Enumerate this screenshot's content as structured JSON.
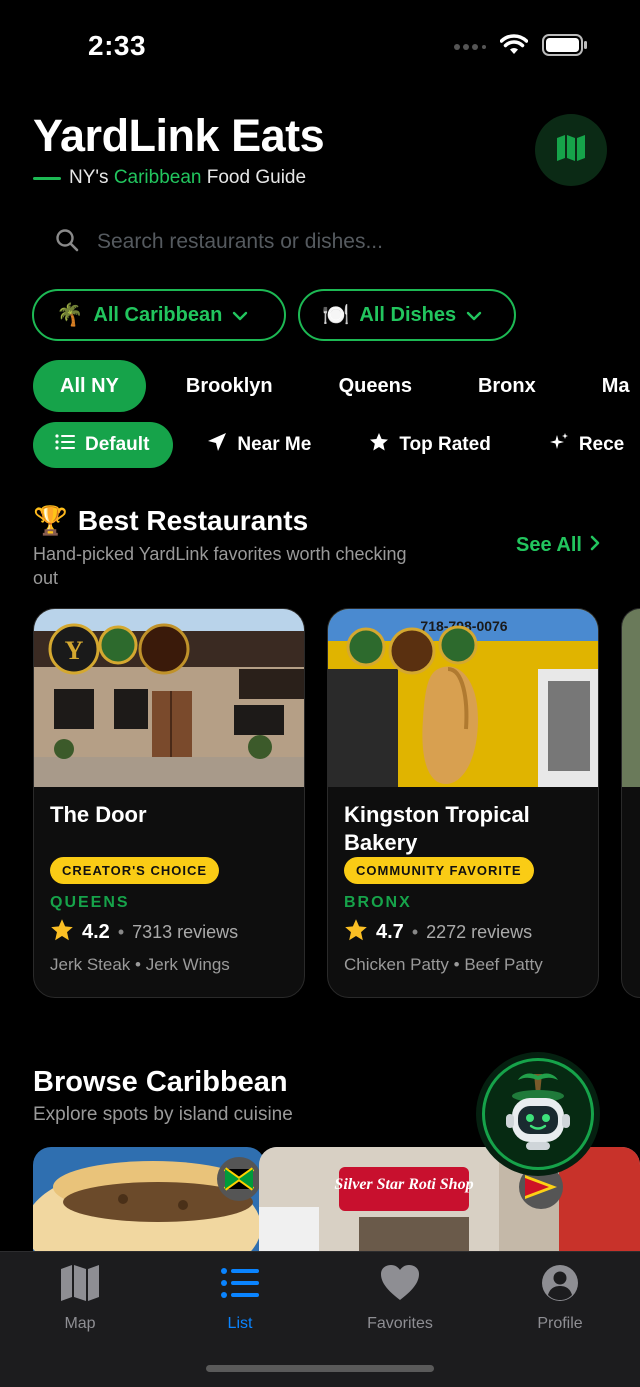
{
  "status_bar": {
    "time": "2:33"
  },
  "header": {
    "title": "YardLink Eats",
    "subtitle_pre": "NY's ",
    "subtitle_highlight": "Caribbean",
    "subtitle_post": " Food Guide"
  },
  "search": {
    "placeholder": "Search restaurants or dishes..."
  },
  "filters": [
    {
      "emoji": "🌴",
      "label": "All Caribbean"
    },
    {
      "emoji": "🍽️",
      "label": "All Dishes"
    }
  ],
  "boroughs": [
    "All NY",
    "Brooklyn",
    "Queens",
    "Bronx",
    "Ma"
  ],
  "sorts": [
    "Default",
    "Near Me",
    "Top Rated",
    "Rece"
  ],
  "best": {
    "emoji": "🏆",
    "title": "Best Restaurants",
    "subtitle": "Hand-picked YardLink favorites worth checking out",
    "see_all": "See All",
    "cards": [
      {
        "name": "The Door",
        "badge": "CREATOR'S CHOICE",
        "borough": "QUEENS",
        "rating": "4.2",
        "reviews": "7313 reviews",
        "dish1": "Jerk Steak",
        "dish2": "Jerk Wings"
      },
      {
        "name": "Kingston Tropical Bakery",
        "badge": "COMMUNITY FAVORITE",
        "borough": "BRONX",
        "rating": "4.7",
        "reviews": "2272 reviews",
        "dish1": "Chicken Patty",
        "dish2": "Beef Patty",
        "sign_phone": "718-798-0076"
      }
    ]
  },
  "browse": {
    "title": "Browse Caribbean",
    "subtitle": "Explore spots by island cuisine",
    "sign_text": "Silver Star Roti Shop"
  },
  "tabbar": [
    {
      "label": "Map",
      "icon": "map-icon"
    },
    {
      "label": "List",
      "icon": "list-icon"
    },
    {
      "label": "Favorites",
      "icon": "heart-icon"
    },
    {
      "label": "Profile",
      "icon": "person-icon"
    }
  ],
  "colors": {
    "accent": "#16a34a",
    "accent_text": "#22c55e",
    "badge": "#facc15",
    "tab_active": "#0a84ff"
  }
}
